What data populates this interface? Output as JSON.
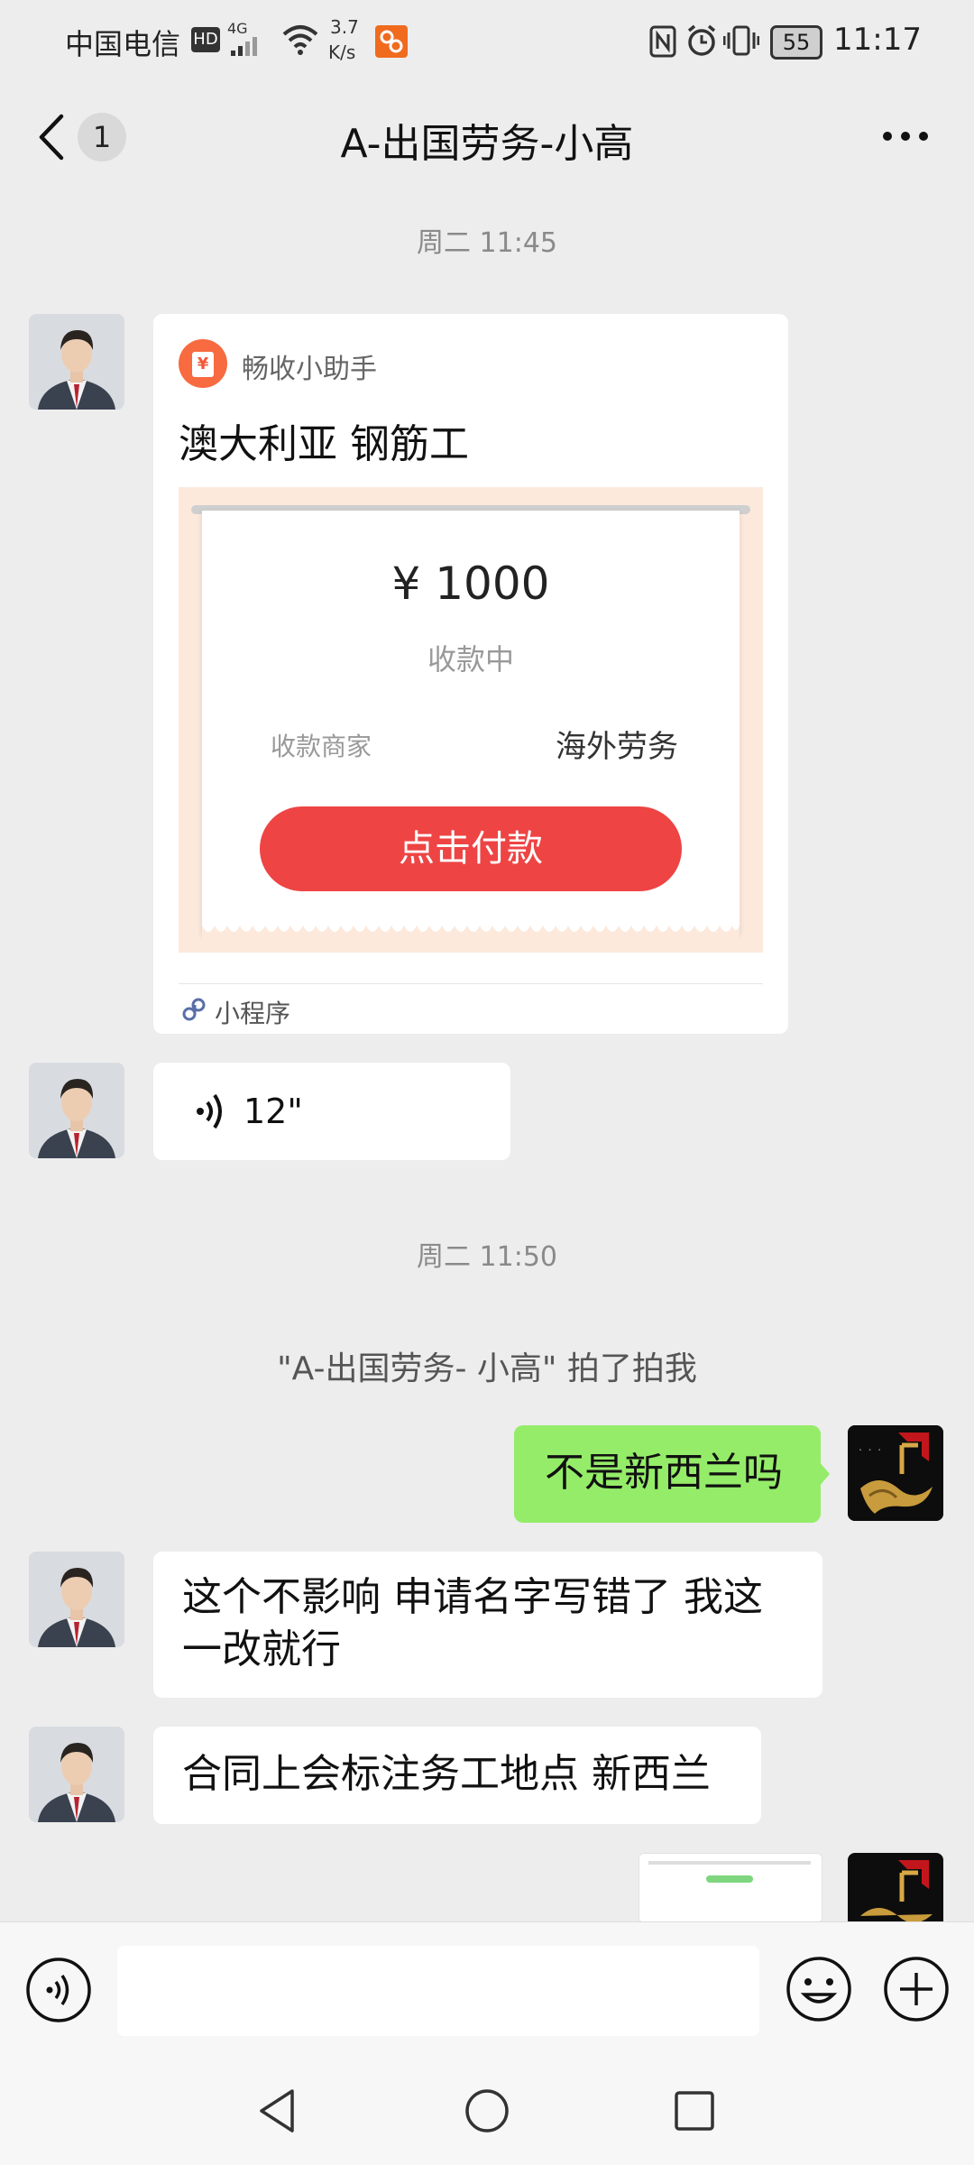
{
  "status_bar": {
    "carrier": "中国电信",
    "hd": "HD",
    "network": "4G",
    "speed_value": "3.7",
    "speed_unit": "K/s",
    "battery": "55",
    "time": "11:17"
  },
  "nav": {
    "unread_count": "1",
    "title": "A-出国劳务-小高"
  },
  "chat": {
    "time1": "周二 11:45",
    "card": {
      "app_name": "畅收小助手",
      "title": "澳大利亚 钢筋工",
      "amount": "¥ 1000",
      "status": "收款中",
      "merchant_label": "收款商家",
      "merchant_value": "海外劳务",
      "pay_button": "点击付款",
      "footer": "小程序"
    },
    "voice_duration": "12\"",
    "time2": "周二 11:50",
    "pat_note": "\"A-出国劳务- 小高\" 拍了拍我",
    "msg_me_1": "不是新西兰吗",
    "msg_them_1_line1": "这个不影响 申请名字写错了 我这",
    "msg_them_1_line2": "一改就行",
    "msg_them_2": "合同上会标注务工地点 新西兰"
  },
  "colors": {
    "background": "#EDEDED",
    "my_bubble": "#95EC69",
    "pay_button": "#EE4444"
  }
}
